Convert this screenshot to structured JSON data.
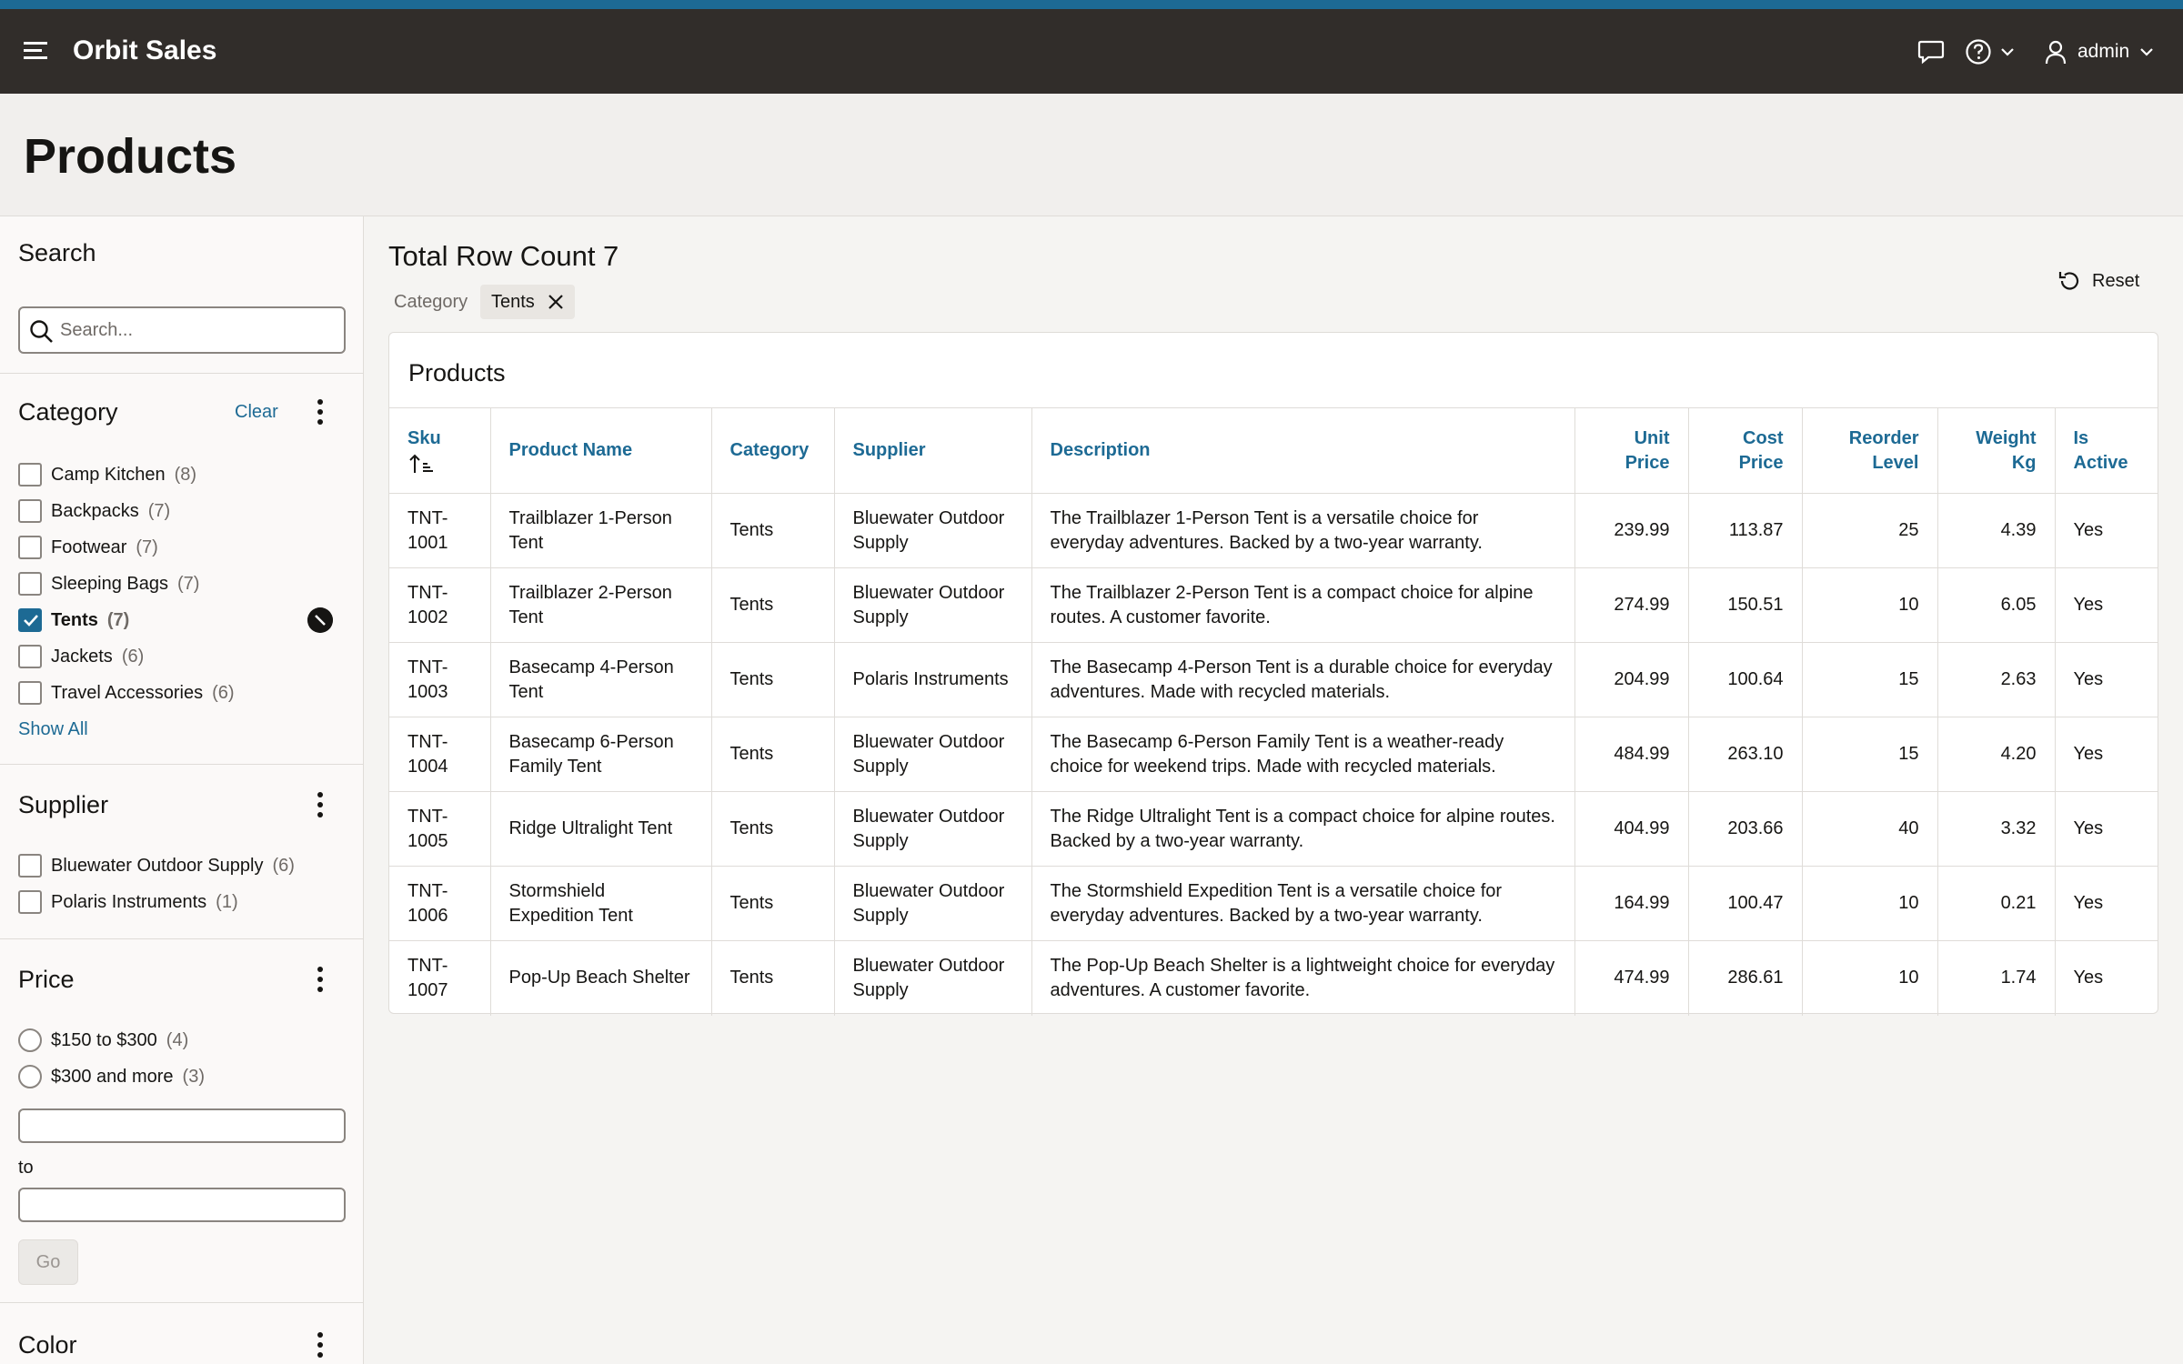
{
  "header": {
    "app_title": "Orbit Sales",
    "user_label": "admin",
    "icons": [
      "hamburger-icon",
      "chat-icon",
      "help-icon",
      "user-icon"
    ]
  },
  "page": {
    "title": "Products"
  },
  "sidebar": {
    "search": {
      "title": "Search",
      "placeholder": "Search..."
    },
    "category": {
      "title": "Category",
      "clear_label": "Clear",
      "items": [
        {
          "label": "Camp Kitchen",
          "count": "(8)",
          "checked": false
        },
        {
          "label": "Backpacks",
          "count": "(7)",
          "checked": false
        },
        {
          "label": "Footwear",
          "count": "(7)",
          "checked": false
        },
        {
          "label": "Sleeping Bags",
          "count": "(7)",
          "checked": false
        },
        {
          "label": "Tents",
          "count": "(7)",
          "checked": true
        },
        {
          "label": "Jackets",
          "count": "(6)",
          "checked": false
        },
        {
          "label": "Travel Accessories",
          "count": "(6)",
          "checked": false
        }
      ],
      "show_all_label": "Show All"
    },
    "supplier": {
      "title": "Supplier",
      "items": [
        {
          "label": "Bluewater Outdoor Supply",
          "count": "(6)",
          "checked": false
        },
        {
          "label": "Polaris Instruments",
          "count": "(1)",
          "checked": false
        }
      ]
    },
    "price": {
      "title": "Price",
      "options": [
        {
          "label": "$150 to $300",
          "count": "(4)"
        },
        {
          "label": "$300 and more",
          "count": "(3)"
        }
      ],
      "to_label": "to",
      "go_label": "Go"
    },
    "color": {
      "title": "Color"
    }
  },
  "main": {
    "row_count_title": "Total Row Count 7",
    "facet_filter": {
      "label": "Category",
      "value": "Tents"
    },
    "reset_label": "Reset",
    "report_title": "Products",
    "columns": [
      {
        "line1": "Sku",
        "line2": ""
      },
      {
        "line1": "Product Name",
        "line2": ""
      },
      {
        "line1": "Category",
        "line2": ""
      },
      {
        "line1": "Supplier",
        "line2": ""
      },
      {
        "line1": "Description",
        "line2": ""
      },
      {
        "line1": "Unit",
        "line2": "Price"
      },
      {
        "line1": "Cost",
        "line2": "Price"
      },
      {
        "line1": "Reorder",
        "line2": "Level"
      },
      {
        "line1": "Weight",
        "line2": "Kg"
      },
      {
        "line1": "Is",
        "line2": "Active"
      }
    ],
    "rows": [
      {
        "sku": "TNT-1001",
        "name": "Trailblazer 1-Person Tent",
        "category": "Tents",
        "supplier": "Bluewater Outdoor Supply",
        "description": "The Trailblazer 1-Person Tent is a versatile choice for everyday adventures. Backed by a two-year warranty.",
        "unit_price": "239.99",
        "cost_price": "113.87",
        "reorder_level": "25",
        "weight_kg": "4.39",
        "is_active": "Yes"
      },
      {
        "sku": "TNT-1002",
        "name": "Trailblazer 2-Person Tent",
        "category": "Tents",
        "supplier": "Bluewater Outdoor Supply",
        "description": "The Trailblazer 2-Person Tent is a compact choice for alpine routes. A customer favorite.",
        "unit_price": "274.99",
        "cost_price": "150.51",
        "reorder_level": "10",
        "weight_kg": "6.05",
        "is_active": "Yes"
      },
      {
        "sku": "TNT-1003",
        "name": "Basecamp 4-Person Tent",
        "category": "Tents",
        "supplier": "Polaris Instruments",
        "description": "The Basecamp 4-Person Tent is a durable choice for everyday adventures. Made with recycled materials.",
        "unit_price": "204.99",
        "cost_price": "100.64",
        "reorder_level": "15",
        "weight_kg": "2.63",
        "is_active": "Yes"
      },
      {
        "sku": "TNT-1004",
        "name": "Basecamp 6-Person Family Tent",
        "category": "Tents",
        "supplier": "Bluewater Outdoor Supply",
        "description": "The Basecamp 6-Person Family Tent is a weather-ready choice for weekend trips. Made with recycled materials.",
        "unit_price": "484.99",
        "cost_price": "263.10",
        "reorder_level": "15",
        "weight_kg": "4.20",
        "is_active": "Yes"
      },
      {
        "sku": "TNT-1005",
        "name": "Ridge Ultralight Tent",
        "category": "Tents",
        "supplier": "Bluewater Outdoor Supply",
        "description": "The Ridge Ultralight Tent is a compact choice for alpine routes. Backed by a two-year warranty.",
        "unit_price": "404.99",
        "cost_price": "203.66",
        "reorder_level": "40",
        "weight_kg": "3.32",
        "is_active": "Yes"
      },
      {
        "sku": "TNT-1006",
        "name": "Stormshield Expedition Tent",
        "category": "Tents",
        "supplier": "Bluewater Outdoor Supply",
        "description": "The Stormshield Expedition Tent is a versatile choice for everyday adventures. Backed by a two-year warranty.",
        "unit_price": "164.99",
        "cost_price": "100.47",
        "reorder_level": "10",
        "weight_kg": "0.21",
        "is_active": "Yes"
      },
      {
        "sku": "TNT-1007",
        "name": "Pop-Up Beach Shelter",
        "category": "Tents",
        "supplier": "Bluewater Outdoor Supply",
        "description": "The Pop-Up Beach Shelter is a lightweight choice for everyday adventures. A customer favorite.",
        "unit_price": "474.99",
        "cost_price": "286.61",
        "reorder_level": "10",
        "weight_kg": "1.74",
        "is_active": "Yes"
      }
    ]
  },
  "colors": {
    "header_bg": "#312d2a",
    "accent": "#1d6a94",
    "top_stripe": "#1d6a94"
  }
}
